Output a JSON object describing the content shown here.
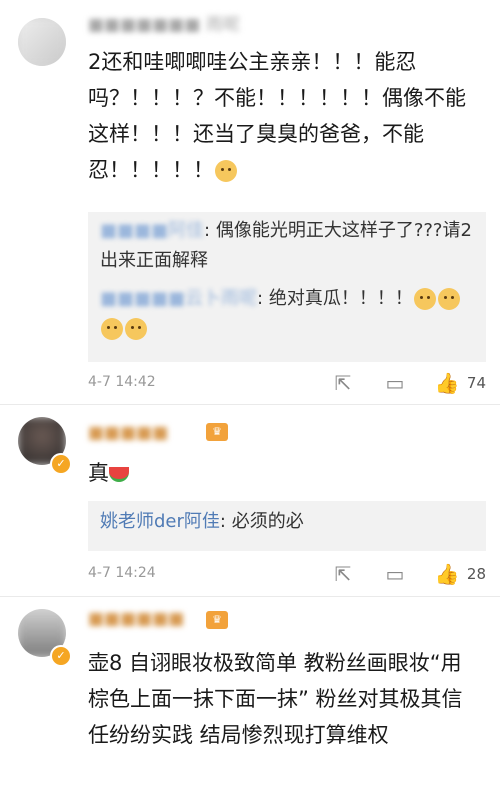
{
  "comments": [
    {
      "username": "■■■■■■■ 雨呢",
      "text": "2还和哇唧唧哇公主亲亲！！！能忍吗？！！！？不能！！！！！！偶像不能这样！！！还当了臭臭的爸爸，不能忍！！！！！",
      "replies": [
        {
          "name": "■■■■阿佳",
          "text": ": 偶像能光明正大这样子了???请2出来正面解释"
        },
        {
          "name": "■■■■■云卜雨呢",
          "text": ": 绝对真瓜！！！！"
        }
      ],
      "time": "4-7 14:42",
      "likes": "74"
    },
    {
      "username": "■■■■■",
      "text": "真",
      "replies": [
        {
          "name": "姚老师der阿佳",
          "text": ": 必须的必"
        }
      ],
      "time": "4-7 14:24",
      "likes": "28"
    },
    {
      "username": "■■■■■■",
      "text": "壶8 自诩眼妆极致简单 教粉丝画眼妆“用棕色上面一抹下面一抹” 粉丝对其极其信任纷纷实践 结局惨烈现打算维权"
    }
  ],
  "icons": [
    "share-icon",
    "reply-icon",
    "like-icon",
    "verified-badge-icon",
    "doge-emoji-icon",
    "watermelon-emoji-icon"
  ],
  "colors": {
    "link": "#507bb5",
    "username": "#d79a52",
    "reply_bg": "#f2f2f2",
    "badge": "#f5a623"
  }
}
